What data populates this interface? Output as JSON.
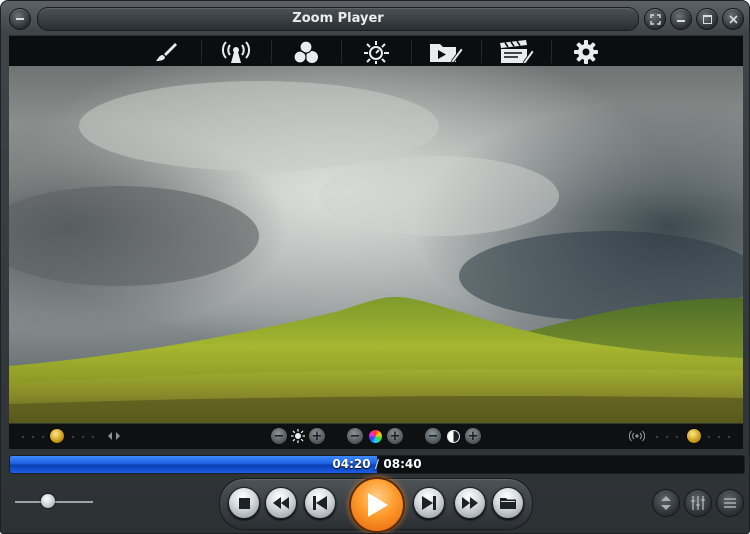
{
  "window": {
    "title": "Zoom Player"
  },
  "playback": {
    "current_time": "04:20",
    "separator": " / ",
    "total_time": "08:40",
    "progress": 0.5,
    "volume": 0.42
  },
  "toolbar": {
    "items": [
      {
        "icon": "brush-icon"
      },
      {
        "icon": "broadcast-icon"
      },
      {
        "icon": "color-circles-icon"
      },
      {
        "icon": "tuner-icon"
      },
      {
        "icon": "video-folder-icon"
      },
      {
        "icon": "clapperboard-icon"
      },
      {
        "icon": "settings-icon"
      }
    ]
  },
  "colors": {
    "accent_blue": "#1c5fe0",
    "play_orange": "#ff9a2a",
    "gold_knob": "#e6b725"
  }
}
